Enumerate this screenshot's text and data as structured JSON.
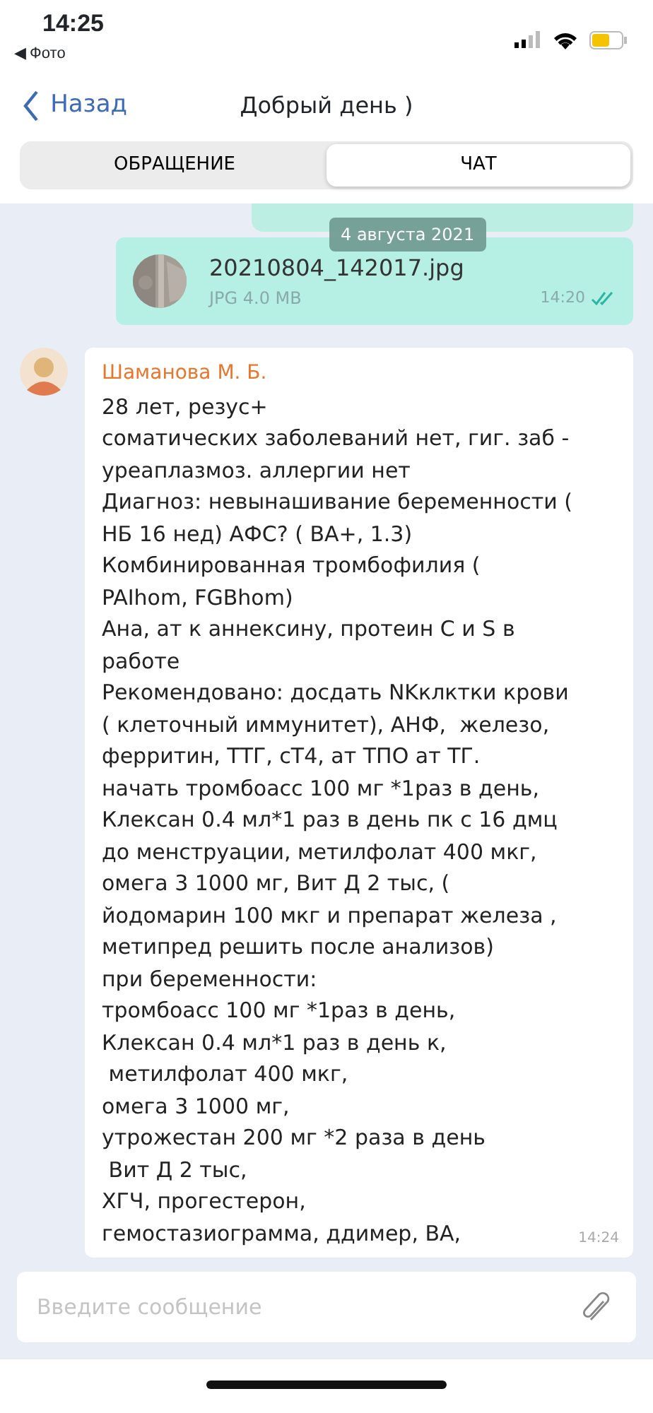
{
  "status_bar": {
    "time": "14:25",
    "back_app": "◀ Фото"
  },
  "nav": {
    "back": "Назад",
    "title": "Добрый день )"
  },
  "tabs": [
    {
      "label": "ОБРАЩЕНИЕ",
      "selected": false
    },
    {
      "label": "ЧАТ",
      "selected": true
    }
  ],
  "date_badge": "4 августа 2021",
  "messages": [
    {
      "kind": "file",
      "outgoing": true,
      "file_name": "20210804_142017.jpg",
      "file_info": "JPG  4.0 MB",
      "time": "14:20",
      "read": true
    },
    {
      "kind": "text",
      "outgoing": false,
      "sender": "Шаманова М. Б.",
      "text": "28 лет, резус+\nсоматических заболеваний нет, гиг. заб - уреаплазмоз. аллергии нет\nДиагноз: невынашивание беременности ( НБ 16 нед) АФС? ( ВА+, 1.3) Комбинированная тромбофилия ( PAIhom, FGBhom)\nАна, ат к аннексину, протеин С и S в работе\nРекомендовано: досдать NKклктки крови ( клеточный иммунитет), АНФ,  железо, ферритин, ТТГ, сТ4, ат ТПО ат ТГ.\nначать тромбоасс 100 мг *1раз в день, Клексан 0.4 мл*1 раз в день пк с 16 дмц до менструации, метилфолат 400 мкг, омега 3 1000 мг, Вит Д 2 тыс, ( йодомарин 100 мкг и препарат железа , метипред решить после анализов)\nпри беременности:\nтромбоасс 100 мг *1раз в день,\nКлексан 0.4 мл*1 раз в день к,\n метилфолат 400 мкг,\nомега 3 1000 мг,\nутрожестан 200 мг *2 раза в день\n Вит Д 2 тыс,\nХГЧ, прогестерон,\nгемостазиограмма, ддимер, ВА,",
      "time": "14:24"
    }
  ],
  "composer": {
    "placeholder": "Введите сообщение"
  }
}
